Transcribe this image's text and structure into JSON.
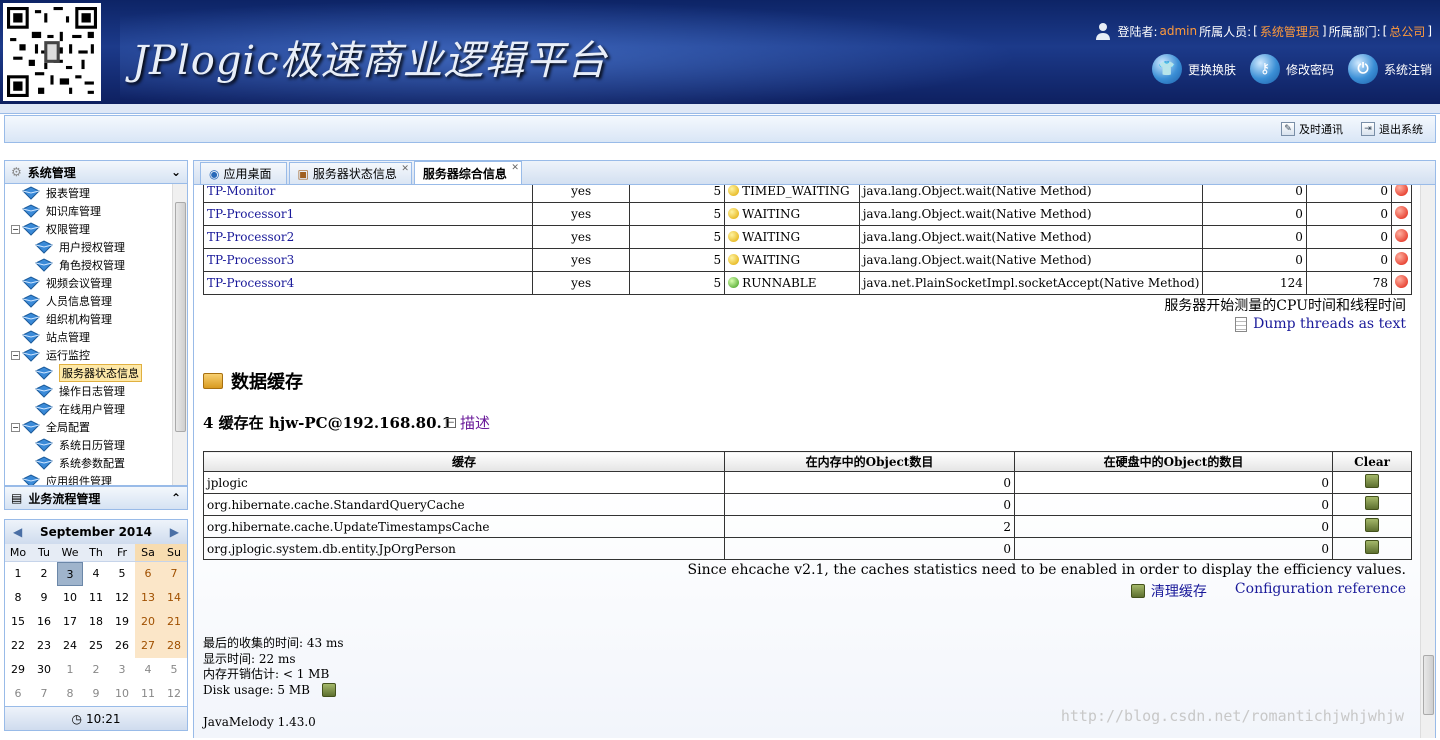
{
  "header": {
    "app_title": "JPlogic极速商业逻辑平台",
    "user_label": "登陆者:",
    "user_name": "admin",
    "role_label": "所属人员:",
    "role_value": "系统管理员",
    "dept_label": "所属部门:",
    "dept_value": "总公司",
    "actions": [
      {
        "label": "更换换肤",
        "icon": "shirt-icon"
      },
      {
        "label": "修改密码",
        "icon": "key-icon"
      },
      {
        "label": "系统注销",
        "icon": "power-icon"
      }
    ]
  },
  "toolbar": {
    "items": [
      {
        "label": "及时通讯",
        "icon": "chat-icon"
      },
      {
        "label": "退出系统",
        "icon": "exit-icon"
      }
    ]
  },
  "sidebar": {
    "panel_title": "系统管理",
    "tree": [
      {
        "label": "报表管理",
        "level": 0
      },
      {
        "label": "知识库管理",
        "level": 0
      },
      {
        "label": "权限管理",
        "level": 0,
        "expanded": true
      },
      {
        "label": "用户授权管理",
        "level": 1
      },
      {
        "label": "角色授权管理",
        "level": 1
      },
      {
        "label": "视频会议管理",
        "level": 0
      },
      {
        "label": "人员信息管理",
        "level": 0
      },
      {
        "label": "组织机构管理",
        "level": 0
      },
      {
        "label": "站点管理",
        "level": 0
      },
      {
        "label": "运行监控",
        "level": 0,
        "expanded": true
      },
      {
        "label": "服务器状态信息",
        "level": 1,
        "selected": true
      },
      {
        "label": "操作日志管理",
        "level": 1
      },
      {
        "label": "在线用户管理",
        "level": 1
      },
      {
        "label": "全局配置",
        "level": 0,
        "expanded": true
      },
      {
        "label": "系统日历管理",
        "level": 1
      },
      {
        "label": "系统参数配置",
        "level": 1
      },
      {
        "label": "应用组件管理",
        "level": 0
      }
    ],
    "panel2_title": "业务流程管理"
  },
  "calendar": {
    "month_label": "September 2014",
    "weekdays": [
      "Mo",
      "Tu",
      "We",
      "Th",
      "Fr",
      "Sa",
      "Su"
    ],
    "weeks": [
      [
        "1",
        "2",
        "3",
        "4",
        "5",
        "6",
        "7"
      ],
      [
        "8",
        "9",
        "10",
        "11",
        "12",
        "13",
        "14"
      ],
      [
        "15",
        "16",
        "17",
        "18",
        "19",
        "20",
        "21"
      ],
      [
        "22",
        "23",
        "24",
        "25",
        "26",
        "27",
        "28"
      ],
      [
        "29",
        "30",
        "1",
        "2",
        "3",
        "4",
        "5"
      ],
      [
        "6",
        "7",
        "8",
        "9",
        "10",
        "11",
        "12"
      ]
    ],
    "today": "3",
    "time": "10:21"
  },
  "tabs": [
    {
      "label": "应用桌面",
      "active": false
    },
    {
      "label": "服务器状态信息",
      "active": false
    },
    {
      "label": "服务器综合信息",
      "active": true
    }
  ],
  "threads": [
    {
      "name": "TP-Monitor",
      "daemon": "yes",
      "priority": "5",
      "state": "TIMED_WAITING",
      "method": "java.lang.Object.wait(Native Method)",
      "cpu": "0",
      "user": "0"
    },
    {
      "name": "TP-Processor1",
      "daemon": "yes",
      "priority": "5",
      "state": "WAITING",
      "method": "java.lang.Object.wait(Native Method)",
      "cpu": "0",
      "user": "0"
    },
    {
      "name": "TP-Processor2",
      "daemon": "yes",
      "priority": "5",
      "state": "WAITING",
      "method": "java.lang.Object.wait(Native Method)",
      "cpu": "0",
      "user": "0"
    },
    {
      "name": "TP-Processor3",
      "daemon": "yes",
      "priority": "5",
      "state": "WAITING",
      "method": "java.lang.Object.wait(Native Method)",
      "cpu": "0",
      "user": "0"
    },
    {
      "name": "TP-Processor4",
      "daemon": "yes",
      "priority": "5",
      "state": "RUNNABLE",
      "method": "java.net.PlainSocketImpl.socketAccept(Native Method)",
      "cpu": "124",
      "user": "78"
    }
  ],
  "cpu_note": "服务器开始测量的CPU时间和线程时间",
  "dump_link": "Dump threads as text",
  "cache_section": {
    "title": "数据缓存",
    "count_label": "4 缓存在 hjw-PC@192.168.80.1",
    "desc_link": "描述",
    "columns": [
      "缓存",
      "在内存中的Object数目",
      "在硬盘中的Object的数目",
      "Clear"
    ],
    "rows": [
      {
        "name": "jplogic",
        "mem": "0",
        "disk": "0"
      },
      {
        "name": "org.hibernate.cache.StandardQueryCache",
        "mem": "0",
        "disk": "0"
      },
      {
        "name": "org.hibernate.cache.UpdateTimestampsCache",
        "mem": "2",
        "disk": "0"
      },
      {
        "name": "org.jplogic.system.db.entity.JpOrgPerson",
        "mem": "0",
        "disk": "0"
      }
    ],
    "note": "Since ehcache v2.1, the caches statistics need to be enabled in order to display the efficiency values.",
    "clear_link": "清理缓存",
    "config_link": "Configuration reference"
  },
  "stats": {
    "collect_time": "最后的收集的时间: 43 ms",
    "display_time": "显示时间: 22 ms",
    "memory": "内存开销估计: < 1 MB",
    "disk": "Disk usage: 5 MB"
  },
  "version": "JavaMelody 1.43.0",
  "watermark": "http://blog.csdn.net/romantichjwhjwhjw"
}
